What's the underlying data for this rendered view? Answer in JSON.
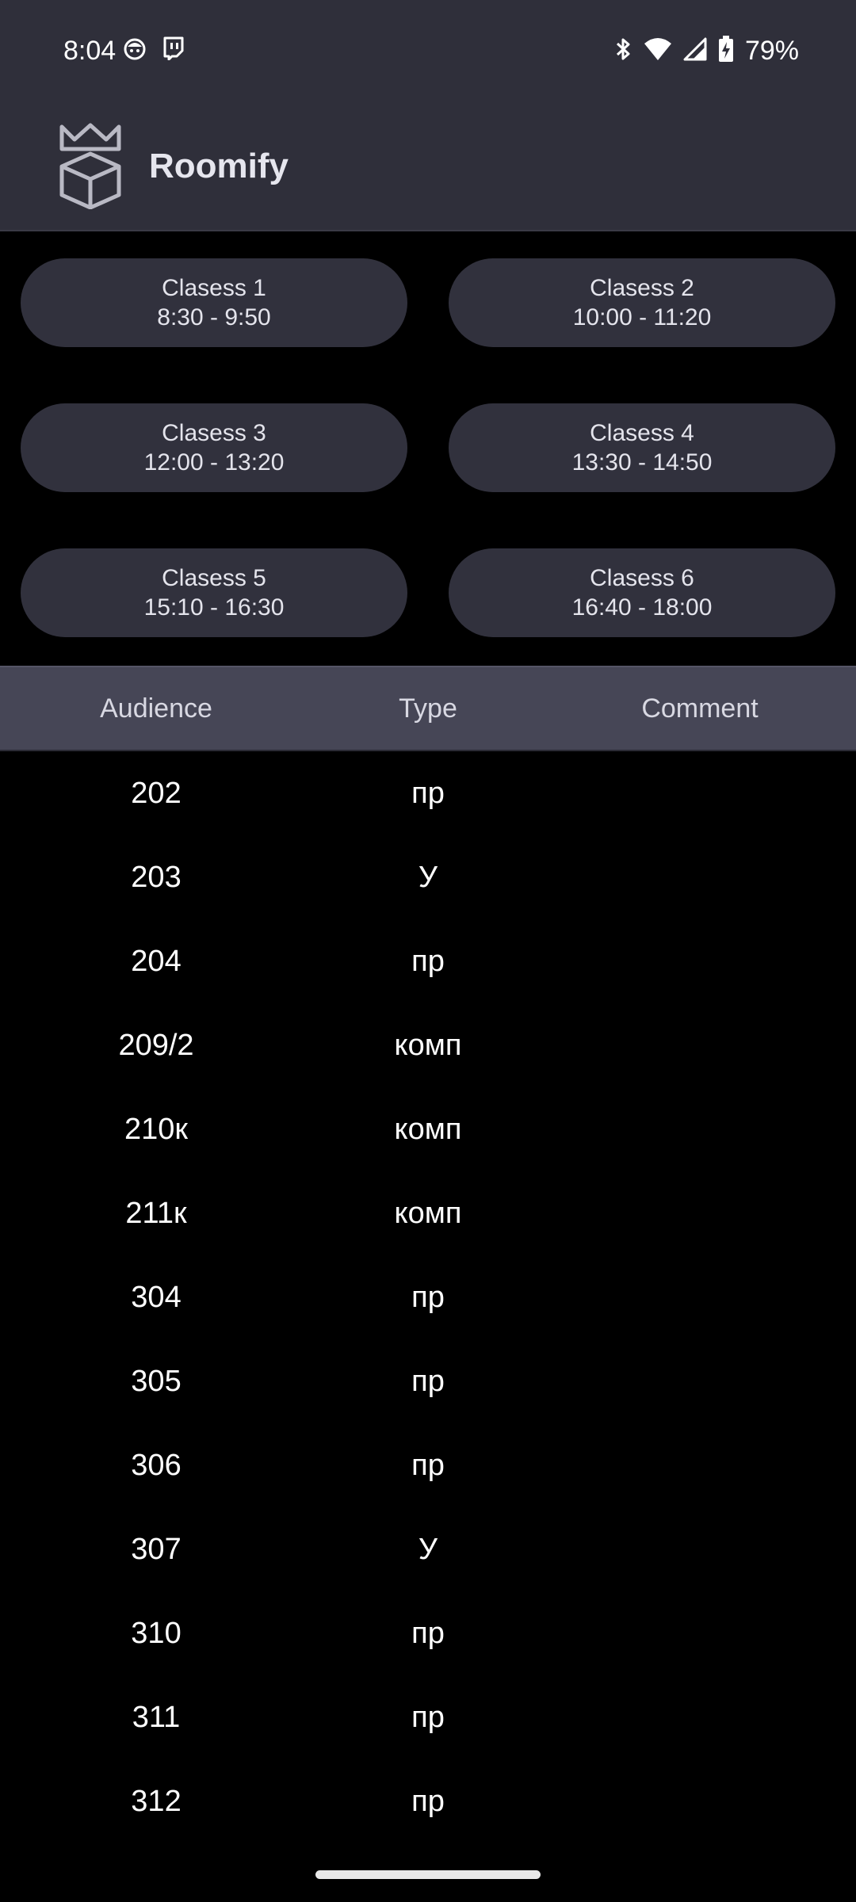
{
  "status_bar": {
    "time": "8:04",
    "battery_percent": "79%",
    "icons": [
      "face-notification-icon",
      "twitch-icon",
      "bluetooth-icon",
      "wifi-icon",
      "cellular-signal-icon",
      "battery-charging-icon"
    ]
  },
  "app_bar": {
    "title": "Roomify",
    "logo_icon": "crown-box-logo"
  },
  "classes": [
    {
      "label": "Clasess 1",
      "time": "8:30 - 9:50"
    },
    {
      "label": "Clasess 2",
      "time": "10:00 - 11:20"
    },
    {
      "label": "Clasess 3",
      "time": "12:00 - 13:20"
    },
    {
      "label": "Clasess 4",
      "time": "13:30 - 14:50"
    },
    {
      "label": "Clasess 5",
      "time": "15:10 - 16:30"
    },
    {
      "label": "Clasess 6",
      "time": "16:40 - 18:00"
    }
  ],
  "table": {
    "headers": {
      "audience": "Audience",
      "type": "Type",
      "comment": "Comment"
    },
    "rows": [
      {
        "audience": "202",
        "type": "пр",
        "comment": ""
      },
      {
        "audience": "203",
        "type": "У",
        "comment": ""
      },
      {
        "audience": "204",
        "type": "пр",
        "comment": ""
      },
      {
        "audience": "209/2",
        "type": "комп",
        "comment": ""
      },
      {
        "audience": "210к",
        "type": "комп",
        "comment": ""
      },
      {
        "audience": "211к",
        "type": "комп",
        "comment": ""
      },
      {
        "audience": "304",
        "type": "пр",
        "comment": ""
      },
      {
        "audience": "305",
        "type": "пр",
        "comment": ""
      },
      {
        "audience": "306",
        "type": "пр",
        "comment": ""
      },
      {
        "audience": "307",
        "type": "У",
        "comment": ""
      },
      {
        "audience": "310",
        "type": "пр",
        "comment": ""
      },
      {
        "audience": "311",
        "type": "пр",
        "comment": ""
      },
      {
        "audience": "312",
        "type": "пр",
        "comment": ""
      }
    ]
  },
  "colors": {
    "background": "#000000",
    "bar_background": "#2f2f3a",
    "button_background": "#31313d",
    "table_header_background": "#464656",
    "text_primary": "#ffffff"
  }
}
